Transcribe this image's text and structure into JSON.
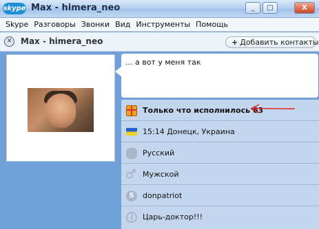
{
  "window": {
    "logo_text": "skype",
    "title": "Max - himera_neo",
    "minimize_glyph": "_",
    "maximize_glyph": "□",
    "close_glyph": "X"
  },
  "menu": {
    "items": [
      {
        "label": "Skype"
      },
      {
        "label": "Разговоры"
      },
      {
        "label": "Звонки"
      },
      {
        "label": "Вид"
      },
      {
        "label": "Инструменты"
      },
      {
        "label": "Помощь"
      }
    ]
  },
  "header": {
    "name": "Max - himera_neo",
    "add_contacts_label": "Добавить контакты"
  },
  "profile": {
    "mood_message": "... а вот у меня так",
    "details": [
      {
        "icon": "gift-icon",
        "text": "Только что исполнилось 63",
        "bold": true
      },
      {
        "icon": "ukraine-flag-icon",
        "text": "15:14 Донецк, Украина",
        "bold": false
      },
      {
        "icon": "language-bubble-icon",
        "text": "Русский",
        "bold": false
      },
      {
        "icon": "male-gender-icon",
        "text": "Мужской",
        "bold": false
      },
      {
        "icon": "skype-icon",
        "text": "donpatriot",
        "bold": false
      },
      {
        "icon": "info-icon",
        "text": "Царь-доктор!!!",
        "bold": false
      }
    ]
  },
  "colors": {
    "accent_blue": "#6fa0d8",
    "details_bg": "#c3d6ee",
    "annotation_arrow": "#e0262b"
  }
}
